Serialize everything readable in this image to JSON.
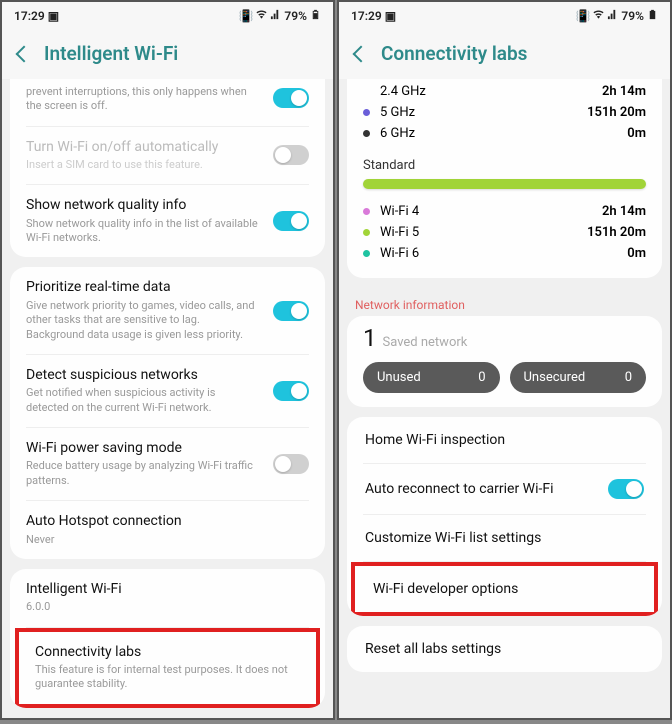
{
  "status": {
    "time": "17:29",
    "battery": "79%"
  },
  "left": {
    "title": "Intelligent Wi-Fi",
    "card1": {
      "partial_text": "prevent interruptions, this only happens when the screen is off.",
      "auto": {
        "title": "Turn Wi-Fi on/off automatically",
        "subtitle": "Insert a SIM card to use this feature."
      },
      "quality": {
        "title": "Show network quality info",
        "subtitle": "Show network quality info in the list of available Wi-Fi networks."
      }
    },
    "card2": {
      "priority": {
        "title": "Prioritize real-time data",
        "subtitle": "Give network priority to games, video calls, and other tasks that are sensitive to lag. Background data usage is given less priority."
      },
      "suspicious": {
        "title": "Detect suspicious networks",
        "subtitle": "Get notified when suspicious activity is detected on the current Wi-Fi network."
      },
      "power": {
        "title": "Wi-Fi power saving mode",
        "subtitle": "Reduce battery usage by analyzing Wi-Fi traffic patterns."
      },
      "hotspot": {
        "title": "Auto Hotspot connection",
        "subtitle": "Never"
      }
    },
    "card3": {
      "intelligent": {
        "title": "Intelligent Wi-Fi",
        "subtitle": "6.0.0"
      },
      "labs": {
        "title": "Connectivity labs",
        "subtitle": "This feature is for internal test purposes. It does not guarantee stability."
      }
    }
  },
  "right": {
    "title": "Connectivity labs",
    "freq": [
      {
        "label": "2.4 GHz",
        "value": "2h 14m",
        "color": "#5aa3e8"
      },
      {
        "label": "5 GHz",
        "value": "151h 20m",
        "color": "#6a5ed8"
      },
      {
        "label": "6 GHz",
        "value": "0m",
        "color": "#333"
      }
    ],
    "standard_label": "Standard",
    "wifi": [
      {
        "label": "Wi-Fi 4",
        "value": "2h 14m",
        "color": "#d97ad9"
      },
      {
        "label": "Wi-Fi 5",
        "value": "151h 20m",
        "color": "#a1d438"
      },
      {
        "label": "Wi-Fi 6",
        "value": "0m",
        "color": "#1fc3a1"
      }
    ],
    "network_info_label": "Network information",
    "saved": {
      "count": "1",
      "label": "Saved network"
    },
    "pills": {
      "unused": "Unused",
      "unused_n": "0",
      "unsecured": "Unsecured",
      "unsecured_n": "0"
    },
    "items": {
      "home": "Home Wi-Fi inspection",
      "auto_reconnect": "Auto reconnect to carrier Wi-Fi",
      "customize": "Customize Wi-Fi list settings",
      "dev": "Wi-Fi developer options",
      "reset": "Reset all labs settings"
    }
  }
}
